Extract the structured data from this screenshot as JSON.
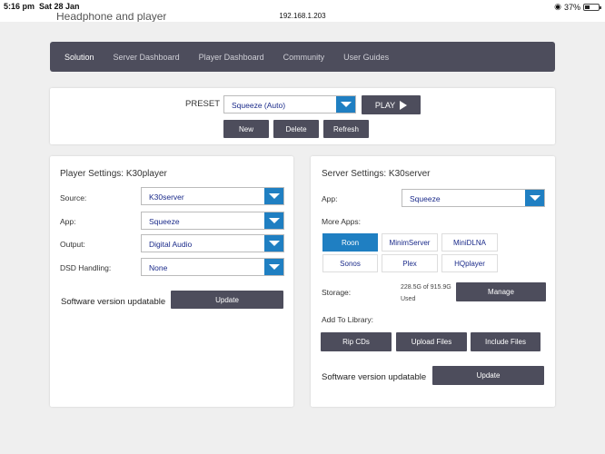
{
  "status": {
    "time": "5:16 pm",
    "date": "Sat 28 Jan",
    "url": "192.168.1.203",
    "battery": "37%",
    "battery_level": 0.37
  },
  "cut_title": "Headphone and player",
  "nav": {
    "items": [
      "Solution",
      "Server Dashboard",
      "Player Dashboard",
      "Community",
      "User Guides"
    ]
  },
  "preset": {
    "label": "PRESET",
    "value": "Squeeze (Auto)",
    "play": "PLAY",
    "new": "New",
    "delete": "Delete",
    "refresh": "Refresh"
  },
  "player": {
    "title": "Player Settings: K30player",
    "source_label": "Source:",
    "source_value": "K30server",
    "app_label": "App:",
    "app_value": "Squeeze",
    "output_label": "Output:",
    "output_value": "Digital Audio",
    "dsd_label": "DSD Handling:",
    "dsd_value": "None",
    "version_text": "Software version updatable",
    "update": "Update"
  },
  "server": {
    "title": "Server Settings: K30server",
    "app_label": "App:",
    "app_value": "Squeeze",
    "more_apps_label": "More Apps:",
    "more_apps": [
      "Roon",
      "MinimServer",
      "MiniDLNA",
      "Sonos",
      "Plex",
      "HQplayer"
    ],
    "storage_label": "Storage:",
    "storage_line1": "228.5G of 915.9G",
    "storage_line2": "Used",
    "manage": "Manage",
    "library_label": "Add To Library:",
    "library_buttons": [
      "Rip CDs",
      "Upload Files",
      "Include Files"
    ],
    "version_text": "Software version updatable",
    "update": "Update"
  },
  "colors": {
    "nav_bg": "#4d4d5c",
    "accent": "#1f7fc2",
    "button_dark": "#4d4d5c",
    "select_text": "#1a2a8a"
  },
  "icons": {
    "dropdown": "triangle-down-icon",
    "play": "play-icon",
    "wifi": "wifi-icon",
    "battery": "battery-icon"
  }
}
